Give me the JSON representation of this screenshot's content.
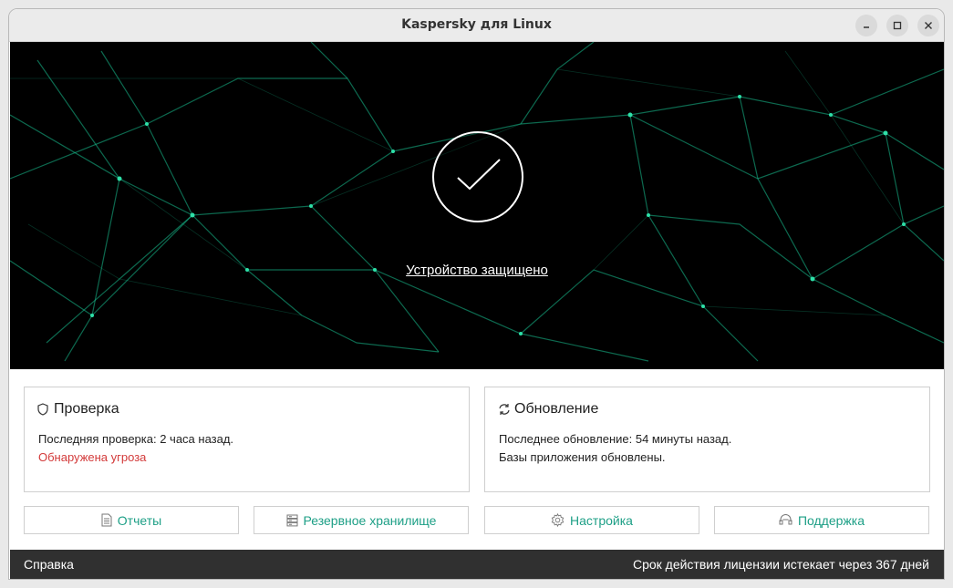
{
  "window": {
    "title": "Kaspersky для Linux"
  },
  "hero": {
    "status": "Устройство защищено"
  },
  "cards": {
    "scan": {
      "title": "Проверка",
      "line1": "Последняя проверка: 2 часа назад.",
      "line2": "Обнаружена угроза"
    },
    "update": {
      "title": "Обновление",
      "line1": "Последнее обновление: 54 минуты назад.",
      "line2": "Базы приложения обновлены."
    }
  },
  "buttons": {
    "reports": "Отчеты",
    "backup": "Резервное хранилище",
    "settings": "Настройка",
    "support": "Поддержка"
  },
  "statusbar": {
    "help": "Справка",
    "license": "Срок действия лицензии истекает через 367 дней"
  },
  "colors": {
    "accent": "#1d9f86",
    "threat": "#d33a3a",
    "hero_bg": "#000000",
    "network": "#18c08f"
  },
  "icons": [
    "minimize-icon",
    "maximize-icon",
    "close-icon",
    "checkmark-icon",
    "shield-icon",
    "refresh-icon",
    "document-icon",
    "storage-icon",
    "gear-icon",
    "support-icon"
  ]
}
